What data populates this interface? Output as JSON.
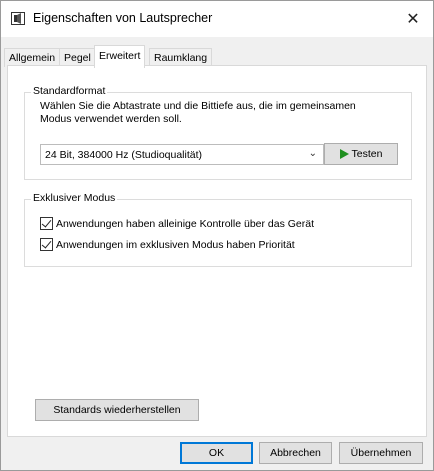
{
  "window": {
    "title": "Eigenschaften von Lautsprecher",
    "close_glyph": "✕"
  },
  "tabs": [
    {
      "label": "Allgemein",
      "active": false
    },
    {
      "label": "Pegel",
      "active": false
    },
    {
      "label": "Erweitert",
      "active": true
    },
    {
      "label": "Raumklang",
      "active": false
    }
  ],
  "standard_format": {
    "group_label": "Standardformat",
    "description": "Wählen Sie die Abtastrate und die Bittiefe aus, die im gemeinsamen Modus verwendet werden soll.",
    "selected_format": "24 Bit, 384000 Hz (Studioqualität)",
    "test_label": "Testen"
  },
  "exclusive_mode": {
    "group_label": "Exklusiver Modus",
    "options": [
      {
        "label": "Anwendungen haben alleinige Kontrolle über das Gerät",
        "checked": true
      },
      {
        "label": "Anwendungen im exklusiven Modus haben Priorität",
        "checked": true
      }
    ]
  },
  "restore_label": "Standards wiederherstellen",
  "footer": {
    "ok_label": "OK",
    "cancel_label": "Abbrechen",
    "apply_label": "Übernehmen"
  },
  "colors": {
    "accent": "#0078d7",
    "play_green": "#1f8f1f"
  },
  "icons": {
    "title": "speaker-icon",
    "close": "close-icon",
    "dropdown": "chevron-down-icon",
    "test": "play-icon"
  }
}
